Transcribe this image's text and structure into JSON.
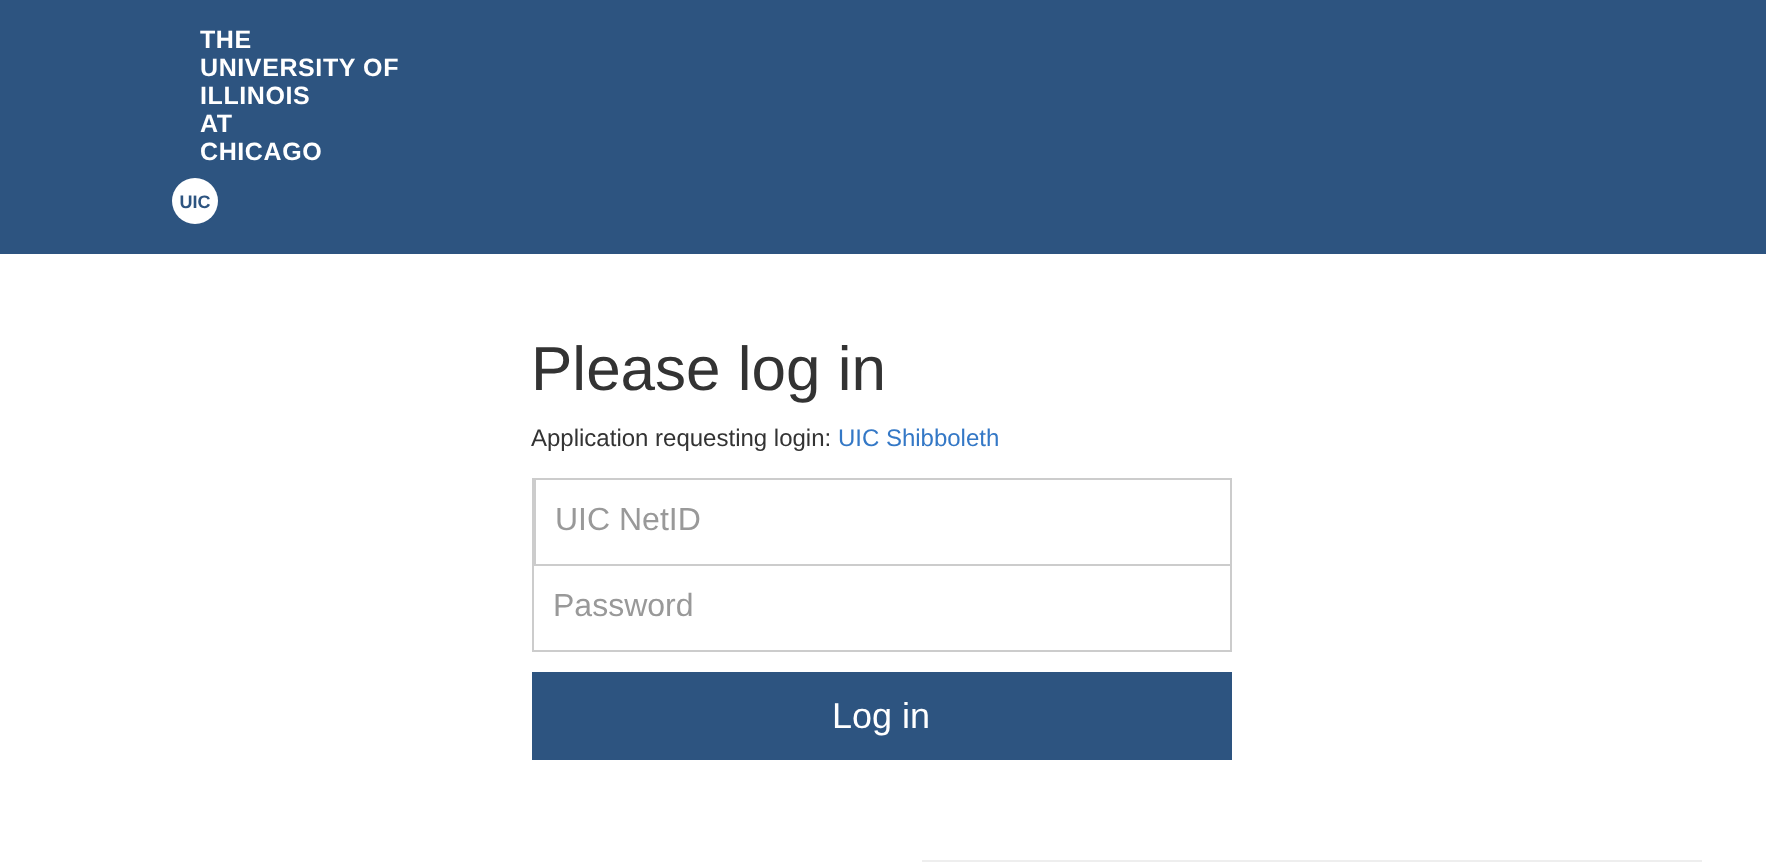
{
  "header": {
    "logo_lines": [
      "THE",
      "UNIVERSITY OF",
      "ILLINOIS",
      "AT",
      "CHICAGO"
    ],
    "badge": "UIC"
  },
  "login": {
    "title": "Please log in",
    "app_label": "Application requesting login:",
    "app_link": "UIC Shibboleth",
    "fields": [
      {
        "placeholder": "UIC NetID",
        "focused": true
      },
      {
        "placeholder": "Password",
        "focused": false
      }
    ],
    "button": "Log in"
  }
}
